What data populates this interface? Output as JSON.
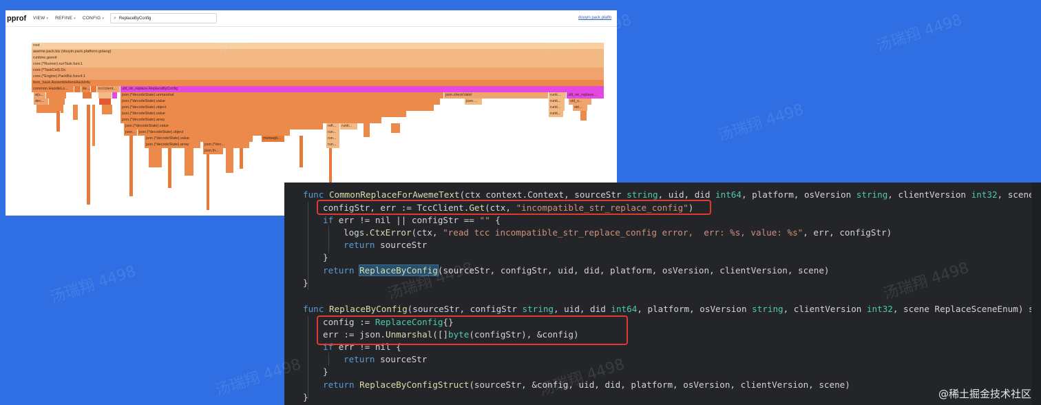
{
  "pprof": {
    "logo": "pprof",
    "menus": [
      {
        "label": "VIEW",
        "caret": "▾"
      },
      {
        "label": "REFINE",
        "caret": "▾"
      },
      {
        "label": "CONFIG",
        "caret": "▾"
      }
    ],
    "search": {
      "icon": "⌕",
      "value": "ReplaceByConfig"
    },
    "link": "douyin.pack.platfo",
    "flame_labels": {
      "root": "root",
      "l1": "aweme.pack.biz (douyin.pack.platform.golang)",
      "l2": "runtime.goexit",
      "l3": "core.(*Runner).runTask.func1",
      "l4": "core.(*TaskCell).Do",
      "l5": "core.(*Engine).PackBiz.func4.1",
      "l6": "item_hack.AssembleItemHackInfo",
      "l7a": "common.HandleLo...",
      "l7b": "ite...",
      "l7c": "tcc/client...",
      "l7d": "util_str_replace.ReplaceByConfig",
      "l8a": "json.(*decodeState).unmarshal",
      "l8b": "json.checkValid",
      "l8c": "runti...",
      "l8d": "util_str_replace...",
      "l8e": "a(s...",
      "l9a": "json.(*decodeState).value",
      "l9b": "json....",
      "l9c": "runti...",
      "l9d": "util_s...",
      "l9e": "dec...",
      "l10a": "json.(*decodeState).object",
      "l10b": "runti...",
      "l10c": "stri...",
      "l11a": "json.(*decodeState).value",
      "l11b": "runti...",
      "l12a": "json.(*decodeState).array",
      "l13a": "json.(*decodeState).value",
      "l13b": "refl...",
      "l13c": "runti...",
      "l14a": "json...",
      "l14b": "json.(*decodeState).object",
      "l14c": "run...",
      "l15a": "json.(*decodeState).value",
      "l15b": "memeqb...",
      "l15c": "run...",
      "l16a": "json.(*decodeState).array",
      "l16b": "json.(*dec...",
      "l16c": "run...",
      "l17a": "json.In..."
    }
  },
  "code": {
    "lines": {
      "l1": {
        "kw": "func",
        "name": "CommonReplaceForAwemeText",
        "rest": "(ctx context.Context, sourceStr ",
        "t1": "string",
        "r2": ", uid, did ",
        "t2": "int64",
        "r3": ", platform, osVersion ",
        "t3": "string",
        "r4": ", clientVersion ",
        "t4": "int32",
        "r5": ", scene R"
      },
      "l2": {
        "a": "configStr, err := TccClient.",
        "fn": "Get",
        "b": "(ctx, ",
        "s": "\"incompatible_str_replace_config\"",
        "c": ")"
      },
      "l3": {
        "kw": "if",
        "a": " err != nil || configStr == ",
        "s": "\"\"",
        "b": " {"
      },
      "l4": {
        "a": "logs.",
        "fn": "CtxError",
        "b": "(ctx, ",
        "s": "\"read tcc incompatible_str_replace_config error,  err: %s, value: %s\"",
        "c": ", err, configStr)"
      },
      "l5": {
        "kw": "return",
        "a": " sourceStr"
      },
      "l6": {
        "a": "}"
      },
      "l7": {
        "kw": "return",
        "fn": "ReplaceByConfig",
        "a": "(sourceStr, configStr, uid, did, platform, osVersion, clientVersion, scene)"
      },
      "l8": {
        "a": "}"
      },
      "l9": {
        "kw": "func",
        "name": "ReplaceByConfig",
        "rest": "(sourceStr, configStr ",
        "t1": "string",
        "r2": ", uid, did ",
        "t2": "int64",
        "r3": ", platform, osVersion ",
        "t3": "string",
        "r4": ", clientVersion ",
        "t4": "int32",
        "r5": ", scene ReplaceSceneEnum) str"
      },
      "l10": {
        "a": "config := ",
        "fn": "ReplaceConfig",
        "b": "{}"
      },
      "l11": {
        "a": "err := json.",
        "fn": "Unmarshal",
        "b": "([]",
        "ty": "byte",
        "c": "(configStr), &config)"
      },
      "l12": {
        "kw": "if",
        "a": " err != nil {"
      },
      "l13": {
        "kw": "return",
        "a": " sourceStr"
      },
      "l14": {
        "a": "}"
      },
      "l15": {
        "kw": "return",
        "fn": "ReplaceByConfigStruct",
        "a": "(sourceStr, &config, uid, did, platform, osVersion, clientVersion, scene)"
      },
      "l16": {
        "a": "}"
      }
    },
    "watermark_brand": "@稀土掘金技术社区"
  },
  "watermarks": [
    "汤瑞翔 4498"
  ]
}
